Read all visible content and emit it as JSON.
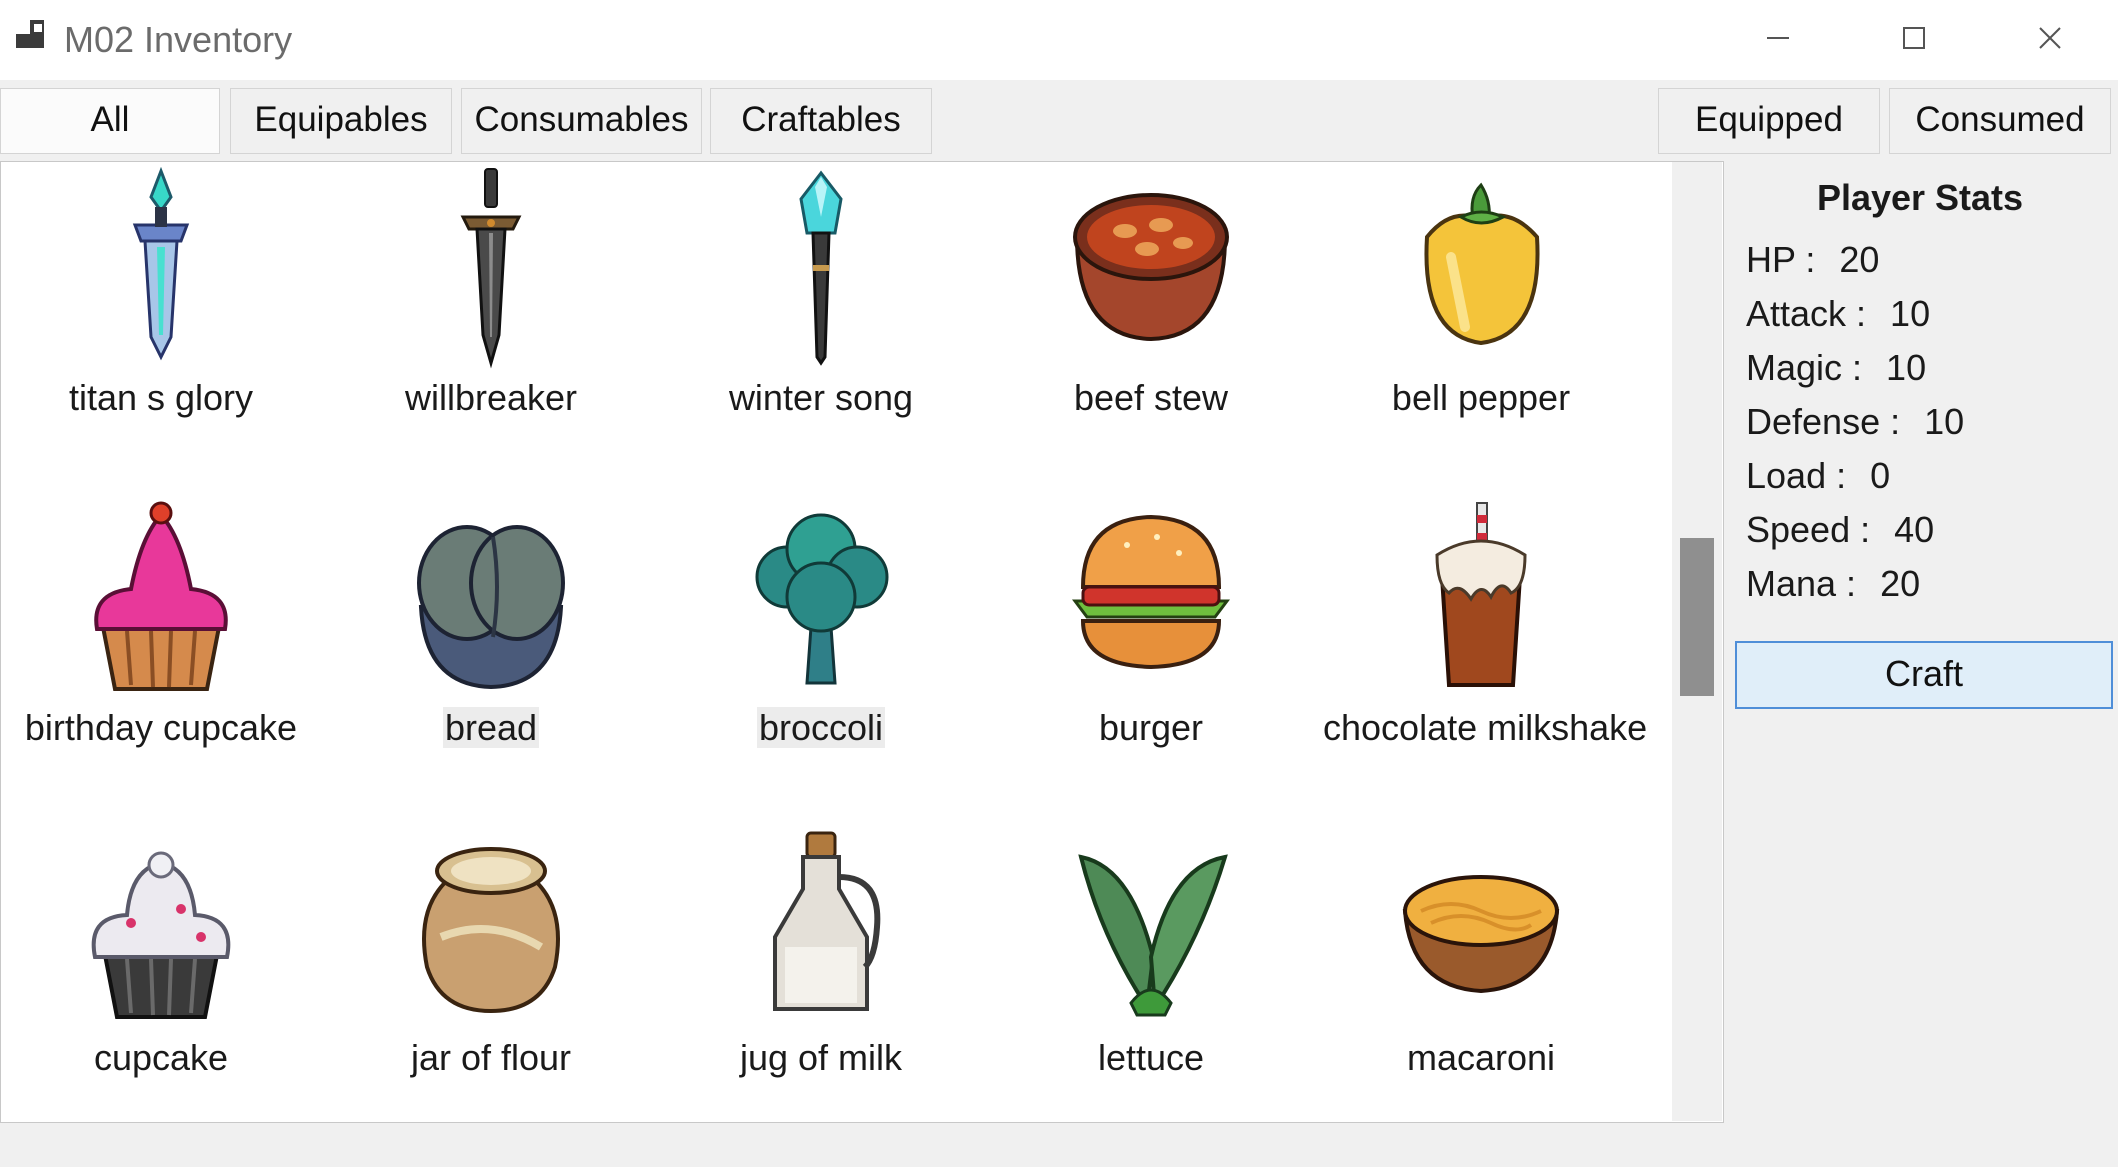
{
  "window": {
    "title": "M02 Inventory"
  },
  "tabs": [
    "All",
    "Equipables",
    "Consumables",
    "Craftables"
  ],
  "right_tabs": [
    "Equipped",
    "Consumed"
  ],
  "items": [
    {
      "label": "titan s glory",
      "icon": "sword-icon"
    },
    {
      "label": "willbreaker",
      "icon": "sword-icon"
    },
    {
      "label": "winter song",
      "icon": "staff-icon"
    },
    {
      "label": "beef stew",
      "icon": "stew-icon"
    },
    {
      "label": "bell pepper",
      "icon": "pepper-icon"
    },
    {
      "label": "birthday cupcake",
      "icon": "cupcake-icon"
    },
    {
      "label": "bread",
      "icon": "bread-icon"
    },
    {
      "label": "broccoli",
      "icon": "broccoli-icon"
    },
    {
      "label": "burger",
      "icon": "burger-icon"
    },
    {
      "label": "chocolate milkshake",
      "icon": "milkshake-icon"
    },
    {
      "label": "cupcake",
      "icon": "cupcake-icon"
    },
    {
      "label": "jar of flour",
      "icon": "jar-icon"
    },
    {
      "label": "jug of milk",
      "icon": "jug-icon"
    },
    {
      "label": "lettuce",
      "icon": "lettuce-icon"
    },
    {
      "label": "macaroni",
      "icon": "macaroni-icon"
    }
  ],
  "stats": {
    "title": "Player Stats",
    "rows": [
      {
        "label": "HP :",
        "value": "20"
      },
      {
        "label": "Attack :",
        "value": "10"
      },
      {
        "label": "Magic :",
        "value": "10"
      },
      {
        "label": "Defense :",
        "value": "10"
      },
      {
        "label": "Load :",
        "value": "0"
      },
      {
        "label": "Speed :",
        "value": "40"
      },
      {
        "label": "Mana :",
        "value": "20"
      }
    ],
    "craft_label": "Craft"
  }
}
